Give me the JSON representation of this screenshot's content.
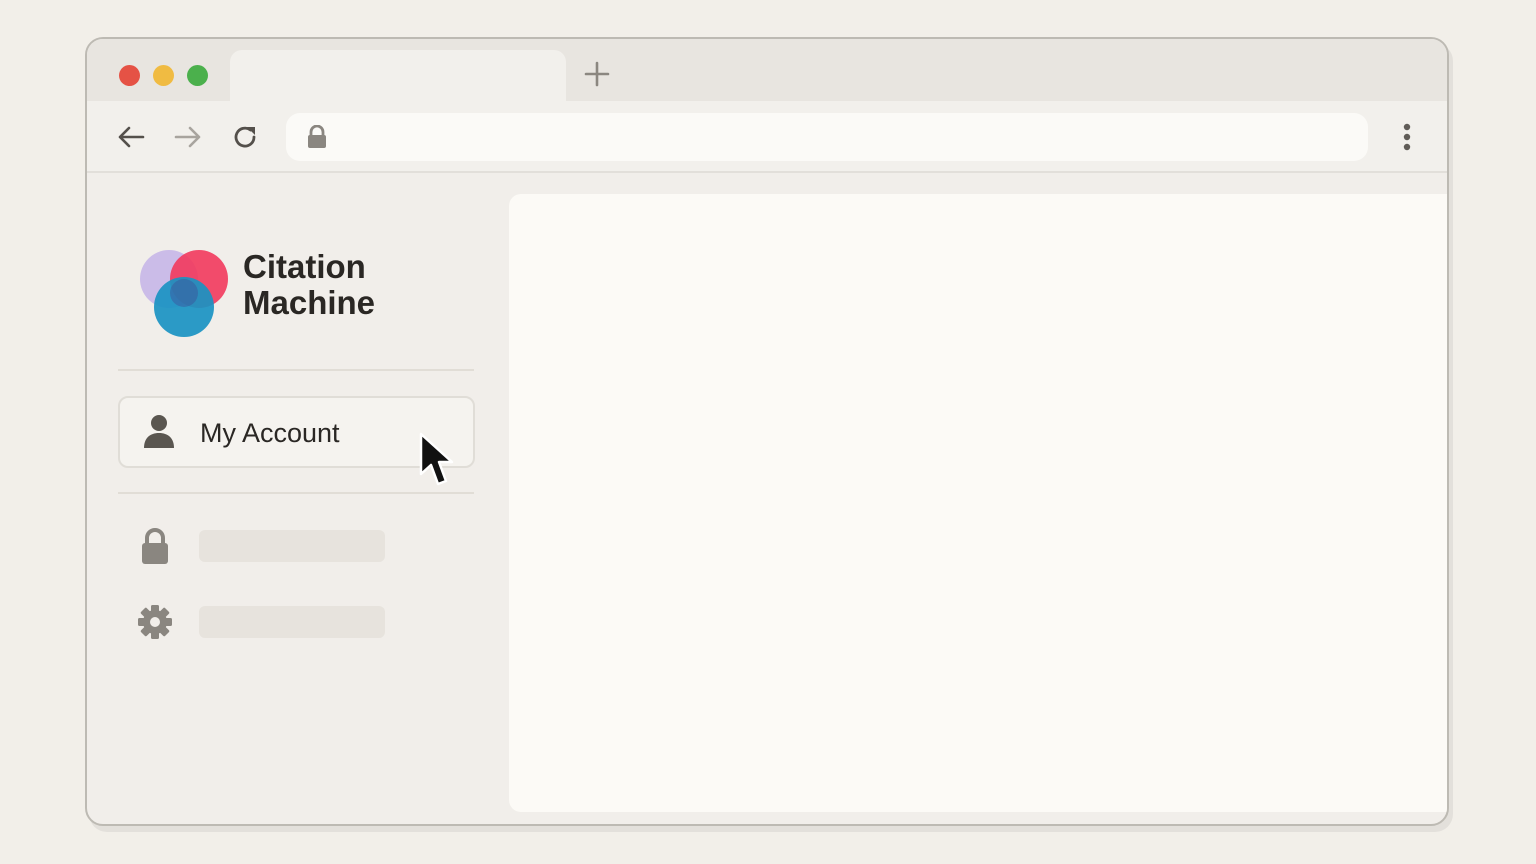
{
  "app": {
    "brand_line1": "Citation",
    "brand_line2": "Machine"
  },
  "browser": {
    "url": "",
    "icons": [
      "close-dot",
      "minimize-dot",
      "maximize-dot",
      "plus-icon",
      "back-arrow-icon",
      "forward-arrow-icon",
      "reload-icon",
      "lock-icon",
      "more-vert-icon"
    ]
  },
  "sidebar": {
    "account_label": "My Account",
    "items": [
      {
        "icon": "lock-icon",
        "label": ""
      },
      {
        "icon": "gear-icon",
        "label": ""
      }
    ]
  },
  "colors": {
    "logo_purple": "#c6b6e8",
    "logo_red": "#f2395d",
    "logo_blue": "#1a93c2"
  }
}
